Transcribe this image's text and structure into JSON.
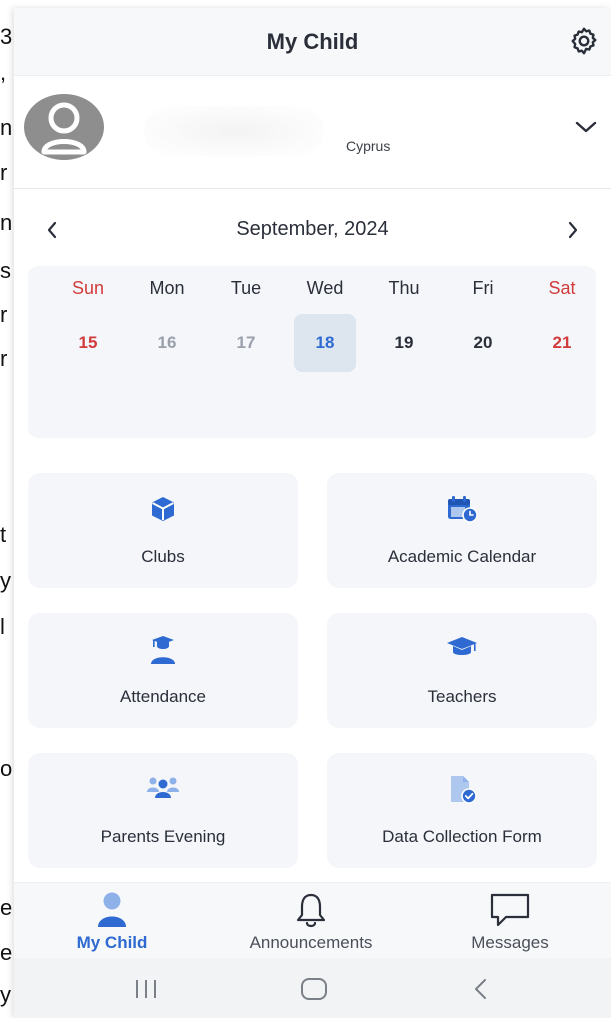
{
  "background_text": [
    "3",
    ",",
    "n",
    "r",
    "n",
    "s",
    "r",
    "r",
    "t",
    "y",
    "l",
    "o",
    "e",
    "e",
    "y"
  ],
  "header": {
    "title": "My Child",
    "settings_icon": "gear-icon"
  },
  "profile": {
    "country": "Cyprus",
    "avatar_icon": "user-avatar-icon",
    "expand_icon": "chevron-down-icon"
  },
  "calendar": {
    "month_label": "September, 2024",
    "days": [
      {
        "name": "Sun",
        "num": "15",
        "state": "weekend"
      },
      {
        "name": "Mon",
        "num": "16",
        "state": "past"
      },
      {
        "name": "Tue",
        "num": "17",
        "state": "past"
      },
      {
        "name": "Wed",
        "num": "18",
        "state": "selected"
      },
      {
        "name": "Thu",
        "num": "19",
        "state": "normal"
      },
      {
        "name": "Fri",
        "num": "20",
        "state": "normal"
      },
      {
        "name": "Sat",
        "num": "21",
        "state": "weekend"
      }
    ]
  },
  "tiles": [
    {
      "label": "Clubs",
      "icon": "cube-icon"
    },
    {
      "label": "Academic Calendar",
      "icon": "calendar-clock-icon"
    },
    {
      "label": "Attendance",
      "icon": "graduate-icon"
    },
    {
      "label": "Teachers",
      "icon": "mortarboard-icon"
    },
    {
      "label": "Parents Evening",
      "icon": "group-icon"
    },
    {
      "label": "Data Collection Form",
      "icon": "document-check-icon"
    }
  ],
  "bottom_nav": [
    {
      "label": "My Child",
      "icon": "person-icon",
      "active": true
    },
    {
      "label": "Announcements",
      "icon": "bell-icon",
      "active": false
    },
    {
      "label": "Messages",
      "icon": "chat-bubble-icon",
      "active": false
    }
  ],
  "colors": {
    "accent": "#2e6ad1",
    "weekend": "#d23b3b",
    "tile_bg": "#f4f6f9",
    "selected_bg": "#dde5ef"
  }
}
